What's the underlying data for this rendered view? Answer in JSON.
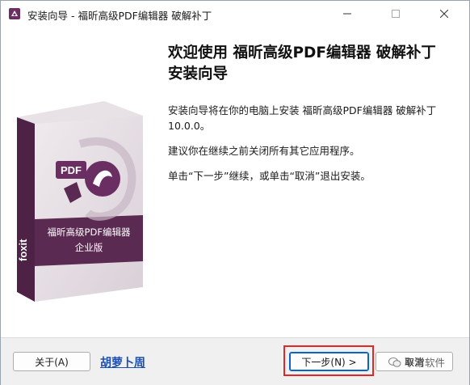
{
  "window": {
    "title": "安装向导 - 福昕高级PDF编辑器 破解补丁",
    "minimize_icon": "minimize-icon",
    "maximize_icon": "maximize-icon",
    "close_icon": "close-icon"
  },
  "content": {
    "heading": "欢迎使用 福昕高级PDF编辑器 破解补丁 安装向导",
    "paragraph1": "安装向导将在你的电脑上安装 福昕高级PDF编辑器 破解补丁 10.0.0。",
    "paragraph2": "建议你在继续之前关闭所有其它应用程序。",
    "paragraph3": "单击“下一步”继续，或单击“取消”退出安装。",
    "box_art": {
      "pdf_label": "PDF",
      "brand": "foxit",
      "product_line1": "福昕高级PDF编辑器",
      "product_line2": "企业版"
    }
  },
  "footer": {
    "about_label": "关于(A)",
    "link_text": "胡萝卜周",
    "next_label": "下一步(N) >",
    "cancel_label": "取消",
    "watermark_text": "平常软件"
  },
  "colors": {
    "box_purple": "#5b2a52",
    "link_blue": "#1d4fb3",
    "highlight_red": "#e0282a"
  }
}
